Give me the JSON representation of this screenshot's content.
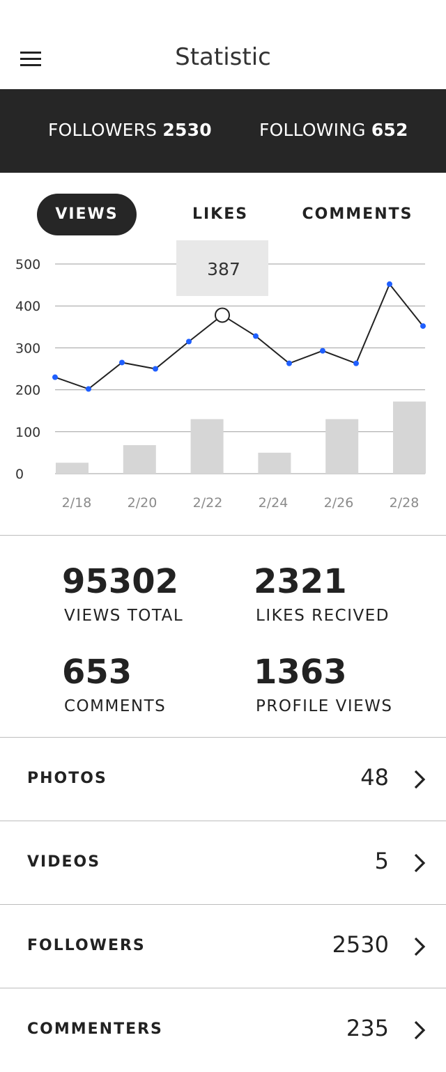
{
  "header": {
    "title": "Statistic",
    "menu_icon": "hamburger-menu-icon"
  },
  "follow": {
    "followers_label": "FOLLOWERS",
    "followers_count": "2530",
    "following_label": "FOLLOWING",
    "following_count": "652"
  },
  "tabs": [
    {
      "label": "VIEWS",
      "active": true
    },
    {
      "label": "LIKES",
      "active": false
    },
    {
      "label": "COMMENTS",
      "active": false
    }
  ],
  "chart_data": {
    "type": "line",
    "y_ticks": [
      "500",
      "400",
      "300",
      "200",
      "100",
      "0"
    ],
    "ylim": [
      0,
      500
    ],
    "x_tick_labels": [
      "2/18",
      "2/20",
      "2/22",
      "2/24",
      "2/26",
      "2/28"
    ],
    "line_series": {
      "values": [
        230,
        202,
        265,
        250,
        315,
        378,
        328,
        263,
        293,
        263,
        452,
        352
      ]
    },
    "bar_series": {
      "values": [
        26,
        68,
        130,
        50,
        130,
        172
      ]
    },
    "highlight": {
      "index": 5,
      "label": "387"
    },
    "colors": {
      "line": "#222222",
      "point": "#1f5fff",
      "bar": "#d6d6d6",
      "grid": "#9e9e9e",
      "tooltip_bg": "#e8e8e8"
    }
  },
  "stats": [
    {
      "value": "95302",
      "label": "VIEWS TOTAL"
    },
    {
      "value": "2321",
      "label": "LIKES RECIVED"
    },
    {
      "value": "653",
      "label": "COMMENTS"
    },
    {
      "value": "1363",
      "label": "PROFILE VIEWS"
    }
  ],
  "rows": [
    {
      "label": "PHOTOS",
      "value": "48"
    },
    {
      "label": "VIDEOS",
      "value": "5"
    },
    {
      "label": "FOLLOWERS",
      "value": "2530"
    },
    {
      "label": "COMMENTERS",
      "value": "235"
    }
  ]
}
